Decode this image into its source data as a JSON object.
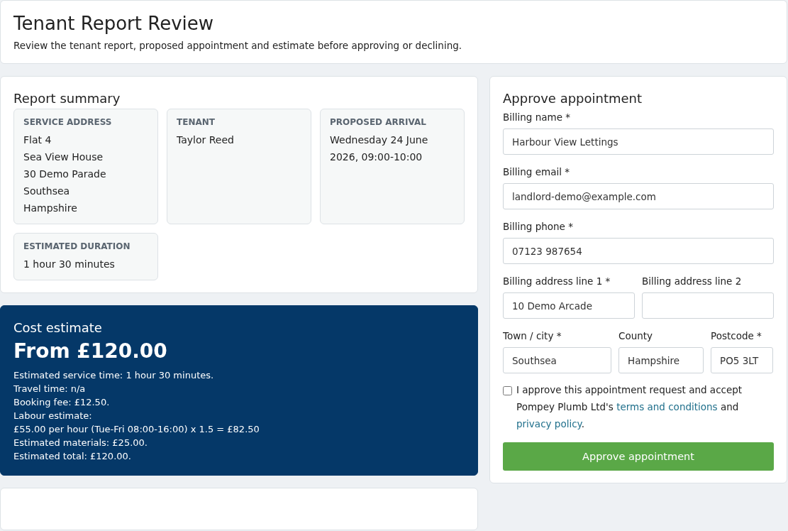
{
  "header": {
    "title": "Tenant Report Review",
    "subtitle": "Review the tenant report, proposed appointment and estimate before approving or declining."
  },
  "summary": {
    "title": "Report summary",
    "items": [
      {
        "label": "SERVICE ADDRESS",
        "lines": [
          "Flat 4",
          "Sea View House",
          "30 Demo Parade",
          "Southsea",
          "Hampshire"
        ]
      },
      {
        "label": "TENANT",
        "lines": [
          "Taylor Reed"
        ]
      },
      {
        "label": "PROPOSED ARRIVAL",
        "lines": [
          "Wednesday 24 June 2026, 09:00-10:00"
        ]
      },
      {
        "label": "ESTIMATED DURATION",
        "lines": [
          "1 hour 30 minutes"
        ]
      }
    ]
  },
  "estimate": {
    "title": "Cost estimate",
    "total": "From £120.00",
    "lines": [
      "Estimated service time: 1 hour 30 minutes.",
      "Travel time: n/a",
      "Booking fee: £12.50.",
      "Labour estimate:",
      "£55.00 per hour (Tue-Fri 08:00-16:00) x 1.5 = £82.50",
      "Estimated materials: £25.00.",
      "Estimated total: £120.00."
    ]
  },
  "form": {
    "title": "Approve appointment",
    "rows": [
      [
        {
          "label": "Billing name *",
          "value": "Harbour View Lettings"
        }
      ],
      [
        {
          "label": "Billing email *",
          "value": "landlord-demo@example.com"
        }
      ],
      [
        {
          "label": "Billing phone *",
          "value": "07123 987654"
        }
      ],
      [
        {
          "label": "Billing address line 1 *",
          "value": "10 Demo Arcade"
        },
        {
          "label": "Billing address line 2"
        }
      ],
      [
        {
          "label": "Town / city *",
          "value": "Southsea"
        },
        {
          "label": "County",
          "value": "Hampshire"
        },
        {
          "label": "Postcode *",
          "value": "PO5 3LT"
        }
      ]
    ],
    "consent": {
      "checked": false,
      "text_before": "I approve this appointment request and accept Pompey Plumb Ltd's",
      "terms_link": "terms and conditions",
      "text_middle": "and",
      "privacy_link": "privacy policy",
      "text_after": "."
    },
    "submit": "Approve appointment"
  }
}
